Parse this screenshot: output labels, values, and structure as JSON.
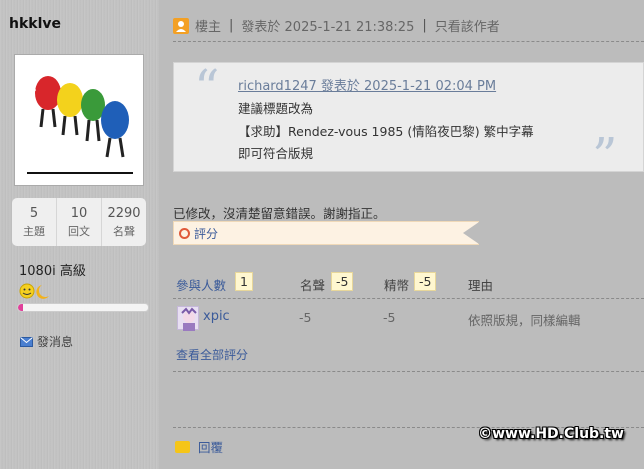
{
  "user": {
    "name": "hkklve",
    "stats": [
      {
        "value": "5",
        "label": "主題"
      },
      {
        "value": "10",
        "label": "回文"
      },
      {
        "value": "2290",
        "label": "名聲"
      }
    ],
    "rank": "1080i 高級",
    "level_progress": 0.04,
    "message_label": "發消息"
  },
  "post": {
    "floor_label": "樓主",
    "posted_at": "發表於 2025-1-21 21:38:25",
    "only_author_label": "只看該作者",
    "quote": {
      "author_line": "richard1247 發表於 2025-1-21 02:04 PM",
      "lines": [
        "建議標題改為",
        "【求助】Rendez-vous 1985 (情陷夜巴黎) 繁中字幕",
        "即可符合版規"
      ]
    },
    "body": "已修改，沒清楚留意錯誤。謝謝指正。",
    "rate_label": "評分"
  },
  "ratings": {
    "participants_label": "參與人數",
    "participants_count": "1",
    "fame_label": "名聲",
    "fame_total": "-5",
    "essence_label": "精幣",
    "essence_total": "-5",
    "reason_label": "理由",
    "rows": [
      {
        "user": "xpic",
        "fame": "-5",
        "essence": "-5",
        "reason": "依照版規，同樣編輯"
      }
    ],
    "view_all_label": "查看全部評分"
  },
  "footer": {
    "reply_label": "回覆",
    "watermark": "©www.HD.Club.tw"
  },
  "colors": {
    "link": "#3b5b9a",
    "accent_orange": "#f3a024",
    "level_bar": "#e0409a"
  }
}
